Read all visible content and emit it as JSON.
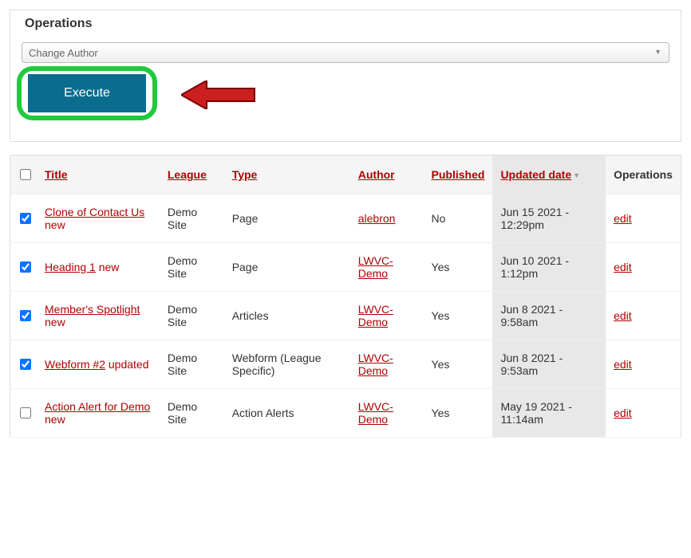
{
  "operations": {
    "legend": "Operations",
    "select_value": "Change Author",
    "execute_label": "Execute"
  },
  "table": {
    "headers": {
      "title": "Title",
      "league": "League",
      "type": "Type",
      "author": "Author",
      "published": "Published",
      "updated": "Updated date",
      "ops": "Operations"
    },
    "rows": [
      {
        "checked": true,
        "title_link": "Clone of Contact Us",
        "title_suffix": " new",
        "league": "Demo Site",
        "type": "Page",
        "author": "alebron",
        "published": "No",
        "updated": "Jun 15 2021 - 12:29pm",
        "edit": "edit"
      },
      {
        "checked": true,
        "title_link": "Heading 1",
        "title_suffix": " new",
        "league": "Demo Site",
        "type": "Page",
        "author": "LWVC-Demo",
        "published": "Yes",
        "updated": "Jun 10 2021 - 1:12pm",
        "edit": "edit"
      },
      {
        "checked": true,
        "title_link": "Member's Spotlight",
        "title_suffix": " new",
        "league": "Demo Site",
        "type": "Articles",
        "author": "LWVC-Demo",
        "published": "Yes",
        "updated": "Jun 8 2021 - 9:58am",
        "edit": "edit"
      },
      {
        "checked": true,
        "title_link": "Webform #2",
        "title_suffix": " updated",
        "league": "Demo Site",
        "type": "Webform (League Specific)",
        "author": "LWVC-Demo",
        "published": "Yes",
        "updated": "Jun 8 2021 - 9:53am",
        "edit": "edit"
      },
      {
        "checked": false,
        "title_link": "Action Alert for Demo",
        "title_suffix": " new",
        "league": "Demo Site",
        "type": "Action Alerts",
        "author": "LWVC-Demo",
        "published": "Yes",
        "updated": "May 19 2021 - 11:14am",
        "edit": "edit"
      }
    ]
  }
}
